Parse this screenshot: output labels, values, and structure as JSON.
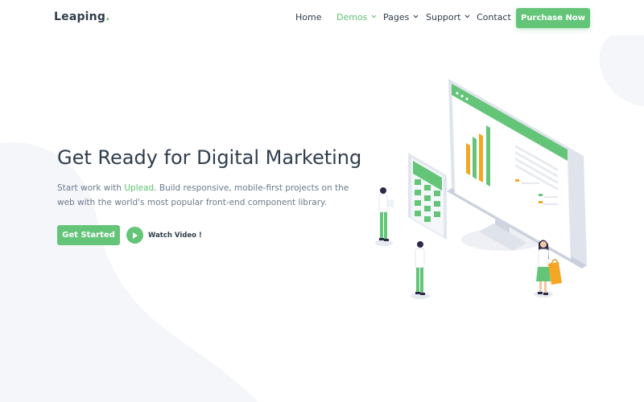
{
  "brand": {
    "name": "Leaping",
    "dot": "."
  },
  "nav": {
    "items": [
      {
        "label": "Home",
        "active": false,
        "dropdown": false
      },
      {
        "label": "Demos",
        "active": true,
        "dropdown": true
      },
      {
        "label": "Pages",
        "active": false,
        "dropdown": true
      },
      {
        "label": "Support",
        "active": false,
        "dropdown": true
      },
      {
        "label": "Contact",
        "active": false,
        "dropdown": false
      }
    ],
    "purchase_label": "Purchase Now"
  },
  "hero": {
    "title": "Get Ready for Digital Marketing",
    "desc_before": "Start work with ",
    "desc_link": "Uplead",
    "desc_after": ". Build responsive, mobile-first projects on the web with the world's most popular front-end component library.",
    "cta_label": "Get Started",
    "video_label": "Watch Video !"
  },
  "icons": {
    "dropdown": "chevron-down-icon",
    "play": "play-icon"
  },
  "colors": {
    "accent": "#64c579",
    "text": "#2f3d4c",
    "muted": "#6c7a89",
    "bar": "#f5a623"
  }
}
